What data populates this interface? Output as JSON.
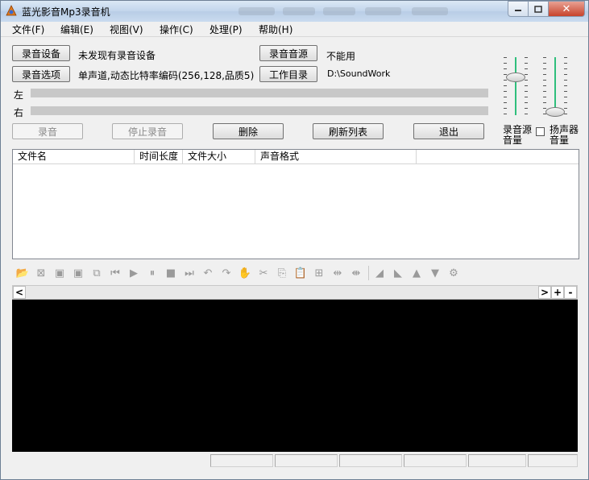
{
  "window": {
    "title": "蓝光影音Mp3录音机"
  },
  "menu": [
    "文件(F)",
    "编辑(E)",
    "视图(V)",
    "操作(C)",
    "处理(P)",
    "帮助(H)"
  ],
  "top_controls": {
    "record_device_button": "录音设备",
    "record_device_value": "未发现有录音设备",
    "record_options_button": "录音选项",
    "record_options_value": "单声道,动态比特率编码(256,128,品质5)",
    "record_source_button": "录音音源",
    "record_source_value": "不能用",
    "work_dir_button": "工作目录",
    "work_dir_value": "D:\\SoundWork"
  },
  "meters": {
    "left_label": "左",
    "right_label": "右"
  },
  "actions": {
    "record": "录音",
    "stop_record": "停止录音",
    "delete": "删除",
    "refresh_list": "刷新列表",
    "exit": "退出"
  },
  "volume": {
    "source_label_1": "录音源",
    "source_label_2": "音量",
    "speaker_label_1": "扬声器",
    "speaker_label_2": "音量"
  },
  "file_list": {
    "columns": [
      "文件名",
      "时间长度",
      "文件大小",
      "声音格式"
    ]
  },
  "toolbar_icons": [
    "open-folder-icon",
    "close-file-icon",
    "save-icon",
    "save-as-icon",
    "export-icon",
    "skip-start-icon",
    "play-icon",
    "pause-icon",
    "stop-icon",
    "skip-end-icon",
    "undo-icon",
    "redo-icon",
    "hand-icon",
    "cut-icon",
    "copy-icon",
    "paste-icon",
    "paste-mix-icon",
    "trim-icon",
    "expand-icon",
    "fade-in-icon",
    "fade-out-icon",
    "volume-up-icon",
    "volume-down-icon",
    "effects-icon"
  ],
  "scroll": {
    "left": "<",
    "right": ">",
    "zoom_in": "+",
    "zoom_out": "-"
  }
}
